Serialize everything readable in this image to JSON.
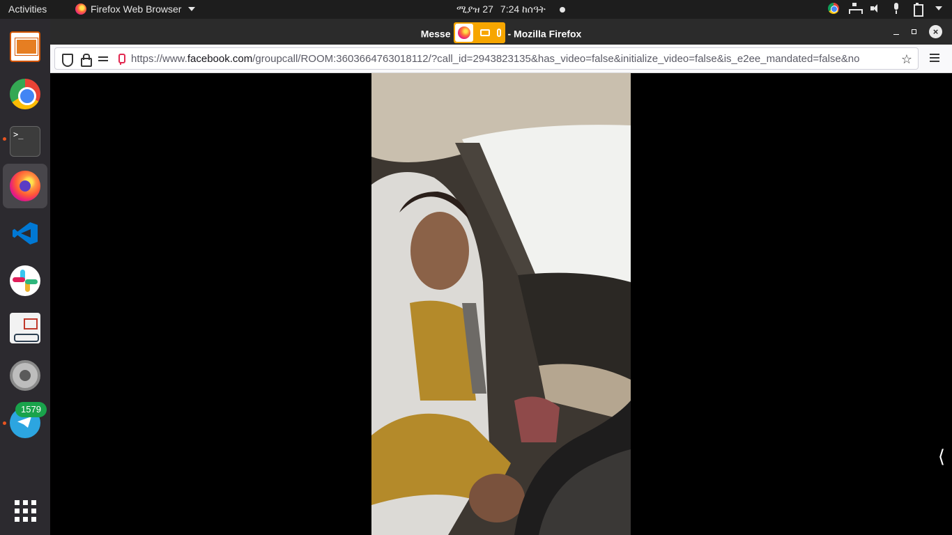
{
  "topbar": {
    "activities": "Activities",
    "app_menu": "Firefox Web Browser",
    "date": "ሚያዝ 27",
    "time": "7:24 ከሰዓት"
  },
  "dock": {
    "items": [
      {
        "name": "LibreOffice Impress",
        "icon": "impress-icon"
      },
      {
        "name": "Google Chrome",
        "icon": "chrome-icon"
      },
      {
        "name": "Terminal",
        "icon": "terminal-icon",
        "glyph": ">_"
      },
      {
        "name": "Firefox",
        "icon": "firefox-icon"
      },
      {
        "name": "Visual Studio Code",
        "icon": "vscode-icon"
      },
      {
        "name": "Slack",
        "icon": "slack-icon"
      },
      {
        "name": "Document Viewer",
        "icon": "reader-icon"
      },
      {
        "name": "Settings",
        "icon": "settings-icon"
      },
      {
        "name": "Telegram",
        "icon": "telegram-icon"
      }
    ],
    "telegram_badge": "1579",
    "show_apps_icon": "grid-icon"
  },
  "window": {
    "title_prefix": "Messe",
    "title_suffix": "- Mozilla Firefox",
    "url_prefix": "https://www.",
    "url_domain": "facebook.com",
    "url_rest": "/groupcall/ROOM:3603664763018112/?call_id=2943823135&has_video=false&initialize_video=false&is_e2ee_mandated=false&no",
    "side_toggle": "⟨"
  },
  "colors": {
    "accent": "#e95420",
    "sharing_indicator": "#f7a600",
    "badge": "#19a34b"
  }
}
